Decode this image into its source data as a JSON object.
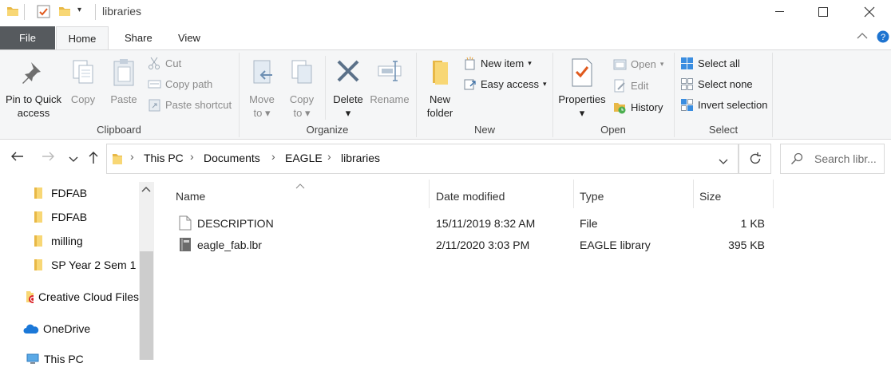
{
  "titlebar": {
    "title": "libraries"
  },
  "tabs": {
    "file": "File",
    "home": "Home",
    "share": "Share",
    "view": "View"
  },
  "ribbon": {
    "clipboard": {
      "label": "Clipboard",
      "pin_line1": "Pin to Quick",
      "pin_line2": "access",
      "copy": "Copy",
      "paste": "Paste",
      "cut": "Cut",
      "copy_path": "Copy path",
      "paste_shortcut": "Paste shortcut"
    },
    "organize": {
      "label": "Organize",
      "move_line1": "Move",
      "move_line2": "to",
      "copy_line1": "Copy",
      "copy_line2": "to",
      "delete": "Delete",
      "rename": "Rename"
    },
    "new": {
      "label": "New",
      "folder_line1": "New",
      "folder_line2": "folder",
      "new_item": "New item",
      "easy_access": "Easy access"
    },
    "open": {
      "label": "Open",
      "properties": "Properties",
      "open": "Open",
      "edit": "Edit",
      "history": "History"
    },
    "select": {
      "label": "Select",
      "select_all": "Select all",
      "select_none": "Select none",
      "invert": "Invert selection"
    }
  },
  "address": {
    "crumbs": [
      "This PC",
      "Documents",
      "EAGLE",
      "libraries"
    ],
    "search_placeholder": "Search libr..."
  },
  "nav": {
    "items": [
      {
        "label": "FDFAB"
      },
      {
        "label": "FDFAB"
      },
      {
        "label": "milling"
      },
      {
        "label": "SP Year 2 Sem 1"
      },
      {
        "label": "Creative Cloud Files"
      },
      {
        "label": "OneDrive"
      },
      {
        "label": "This PC"
      }
    ]
  },
  "columns": {
    "name": "Name",
    "date": "Date modified",
    "type": "Type",
    "size": "Size"
  },
  "files": [
    {
      "name": "DESCRIPTION",
      "date": "15/11/2019 8:32 AM",
      "type": "File",
      "size": "1 KB"
    },
    {
      "name": "eagle_fab.lbr",
      "date": "2/11/2020 3:03 PM",
      "type": "EAGLE library",
      "size": "395 KB"
    }
  ],
  "colors": {
    "accent": "#0078d7",
    "folder": "#f8d775",
    "file_tab": "#565a5e"
  }
}
